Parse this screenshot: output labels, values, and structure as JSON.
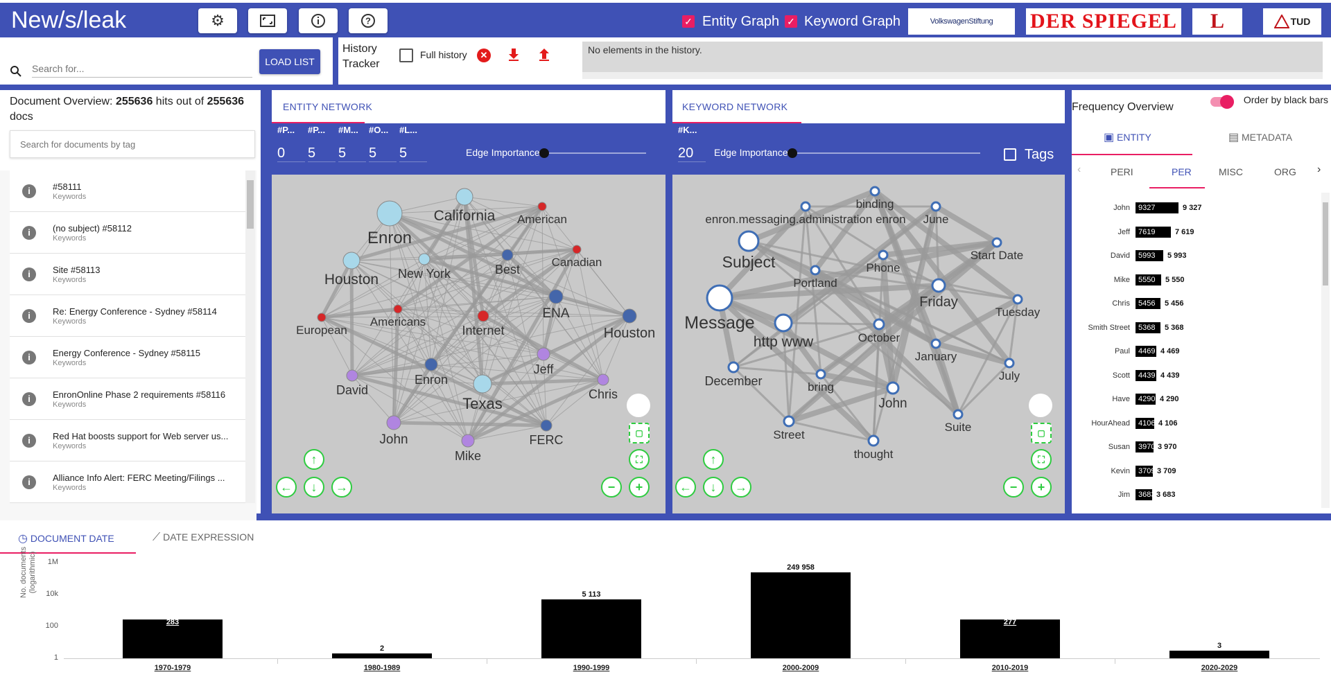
{
  "app": {
    "title": "New/s/leak"
  },
  "topbar": {
    "entity_graph_label": "Entity Graph",
    "keyword_graph_label": "Keyword Graph",
    "logos": [
      "VolkswagenStiftung",
      "DER SPIEGEL",
      "L",
      "TUD"
    ]
  },
  "search": {
    "placeholder": "Search for...",
    "load_list_label": "LOAD LIST"
  },
  "history": {
    "title_line1": "History",
    "title_line2": "Tracker",
    "full_history_label": "Full history",
    "empty_message": "No elements in the history."
  },
  "doc_overview": {
    "prefix": "Document Overview:",
    "hits": "255636",
    "mid": "hits out of",
    "total": "255636",
    "suffix": "docs",
    "tag_placeholder": "Search for documents by tag",
    "items": [
      {
        "title": "#58111",
        "sub": "Keywords"
      },
      {
        "title": "(no subject) #58112",
        "sub": "Keywords"
      },
      {
        "title": "Site #58113",
        "sub": "Keywords"
      },
      {
        "title": "Re: Energy Conference - Sydney #58114",
        "sub": "Keywords"
      },
      {
        "title": "Energy Conference - Sydney #58115",
        "sub": "Keywords"
      },
      {
        "title": "EnronOnline Phase 2 requirements #58116",
        "sub": "Keywords"
      },
      {
        "title": "Red Hat boosts support for Web server us...",
        "sub": "Keywords"
      },
      {
        "title": "Alliance Info Alert: FERC Meeting/Filings ...",
        "sub": "Keywords"
      }
    ]
  },
  "entity_network": {
    "tab_label": "ENTITY NETWORK",
    "controls": [
      {
        "label": "#P...",
        "value": "0"
      },
      {
        "label": "#P...",
        "value": "5"
      },
      {
        "label": "#M...",
        "value": "5"
      },
      {
        "label": "#O...",
        "value": "5"
      },
      {
        "label": "#L...",
        "value": "5"
      }
    ],
    "edge_importance_label": "Edge Importance",
    "nodes": [
      {
        "label": "Enron",
        "color": "#a8d8ea",
        "big": true
      },
      {
        "label": "California",
        "color": "#a8d8ea"
      },
      {
        "label": "American",
        "color": "#d62728"
      },
      {
        "label": "Houston",
        "color": "#a8d8ea"
      },
      {
        "label": "New York",
        "color": "#a8d8ea"
      },
      {
        "label": "Best",
        "color": "#4466aa"
      },
      {
        "label": "Canadian",
        "color": "#d62728"
      },
      {
        "label": "European",
        "color": "#d62728"
      },
      {
        "label": "Americans",
        "color": "#d62728"
      },
      {
        "label": "Internet",
        "color": "#d62728"
      },
      {
        "label": "ENA",
        "color": "#4466aa"
      },
      {
        "label": "Houston",
        "color": "#4466aa"
      },
      {
        "label": "David",
        "color": "#b085e0"
      },
      {
        "label": "Enron",
        "color": "#4466aa"
      },
      {
        "label": "Texas",
        "color": "#a8d8ea"
      },
      {
        "label": "Jeff",
        "color": "#b085e0"
      },
      {
        "label": "Chris",
        "color": "#b085e0"
      },
      {
        "label": "John",
        "color": "#b085e0"
      },
      {
        "label": "FERC",
        "color": "#4466aa"
      },
      {
        "label": "Mike",
        "color": "#b085e0"
      }
    ]
  },
  "keyword_network": {
    "tab_label": "KEYWORD NETWORK",
    "control_label": "#K...",
    "control_value": "20",
    "edge_importance_label": "Edge Importance",
    "tags_label": "Tags",
    "nodes": [
      "binding",
      "enron.messaging.administration enron",
      "June",
      "Subject",
      "Start Date",
      "Phone",
      "Portland",
      "Friday",
      "Message",
      "Tuesday",
      "http www",
      "October",
      "January",
      "December",
      "bring",
      "July",
      "John",
      "Street",
      "Suite",
      "thought"
    ]
  },
  "frequency": {
    "title": "Frequency Overview",
    "order_label": "Order by black bars",
    "tabs": [
      "ENTITY",
      "METADATA"
    ],
    "subtabs": [
      "PERI",
      "PER",
      "MISC",
      "ORG"
    ],
    "rows": [
      {
        "name": "John",
        "value": 9327,
        "label": "9 327"
      },
      {
        "name": "Jeff",
        "value": 7619,
        "label": "7 619"
      },
      {
        "name": "David",
        "value": 5993,
        "label": "5 993"
      },
      {
        "name": "Mike",
        "value": 5550,
        "label": "5 550"
      },
      {
        "name": "Chris",
        "value": 5456,
        "label": "5 456"
      },
      {
        "name": "Smith Street",
        "value": 5368,
        "label": "5 368"
      },
      {
        "name": "Paul",
        "value": 4469,
        "label": "4 469"
      },
      {
        "name": "Scott",
        "value": 4439,
        "label": "4 439"
      },
      {
        "name": "Have",
        "value": 4290,
        "label": "4 290"
      },
      {
        "name": "HourAhead",
        "value": 4106,
        "label": "4 106"
      },
      {
        "name": "Susan",
        "value": 3970,
        "label": "3 970"
      },
      {
        "name": "Kevin",
        "value": 3709,
        "label": "3 709"
      },
      {
        "name": "Jim",
        "value": 3683,
        "label": "3 683"
      }
    ]
  },
  "timeline": {
    "tabs": [
      "DOCUMENT DATE",
      "DATE EXPRESSION"
    ],
    "ylabel_line1": "No. documents",
    "ylabel_line2": "(logarithmic)",
    "yticks": [
      "1M",
      "10k",
      "100",
      "1"
    ]
  },
  "chart_data": {
    "type": "bar",
    "title": "",
    "xlabel": "",
    "ylabel": "No. documents (logarithmic)",
    "yscale": "log",
    "ylim": [
      1,
      1000000
    ],
    "categories": [
      "1970-1979",
      "1980-1989",
      "1990-1999",
      "2000-2009",
      "2010-2019",
      "2020-2029"
    ],
    "values": [
      283,
      2,
      5113,
      249958,
      277,
      3
    ],
    "value_labels": [
      "283",
      "2",
      "5 113",
      "249 958",
      "277",
      "3"
    ]
  },
  "colors": {
    "primary": "#3f51b5",
    "accent": "#e91e63",
    "graph_bg": "#c9c9c9",
    "control_green": "#2ecc40"
  }
}
